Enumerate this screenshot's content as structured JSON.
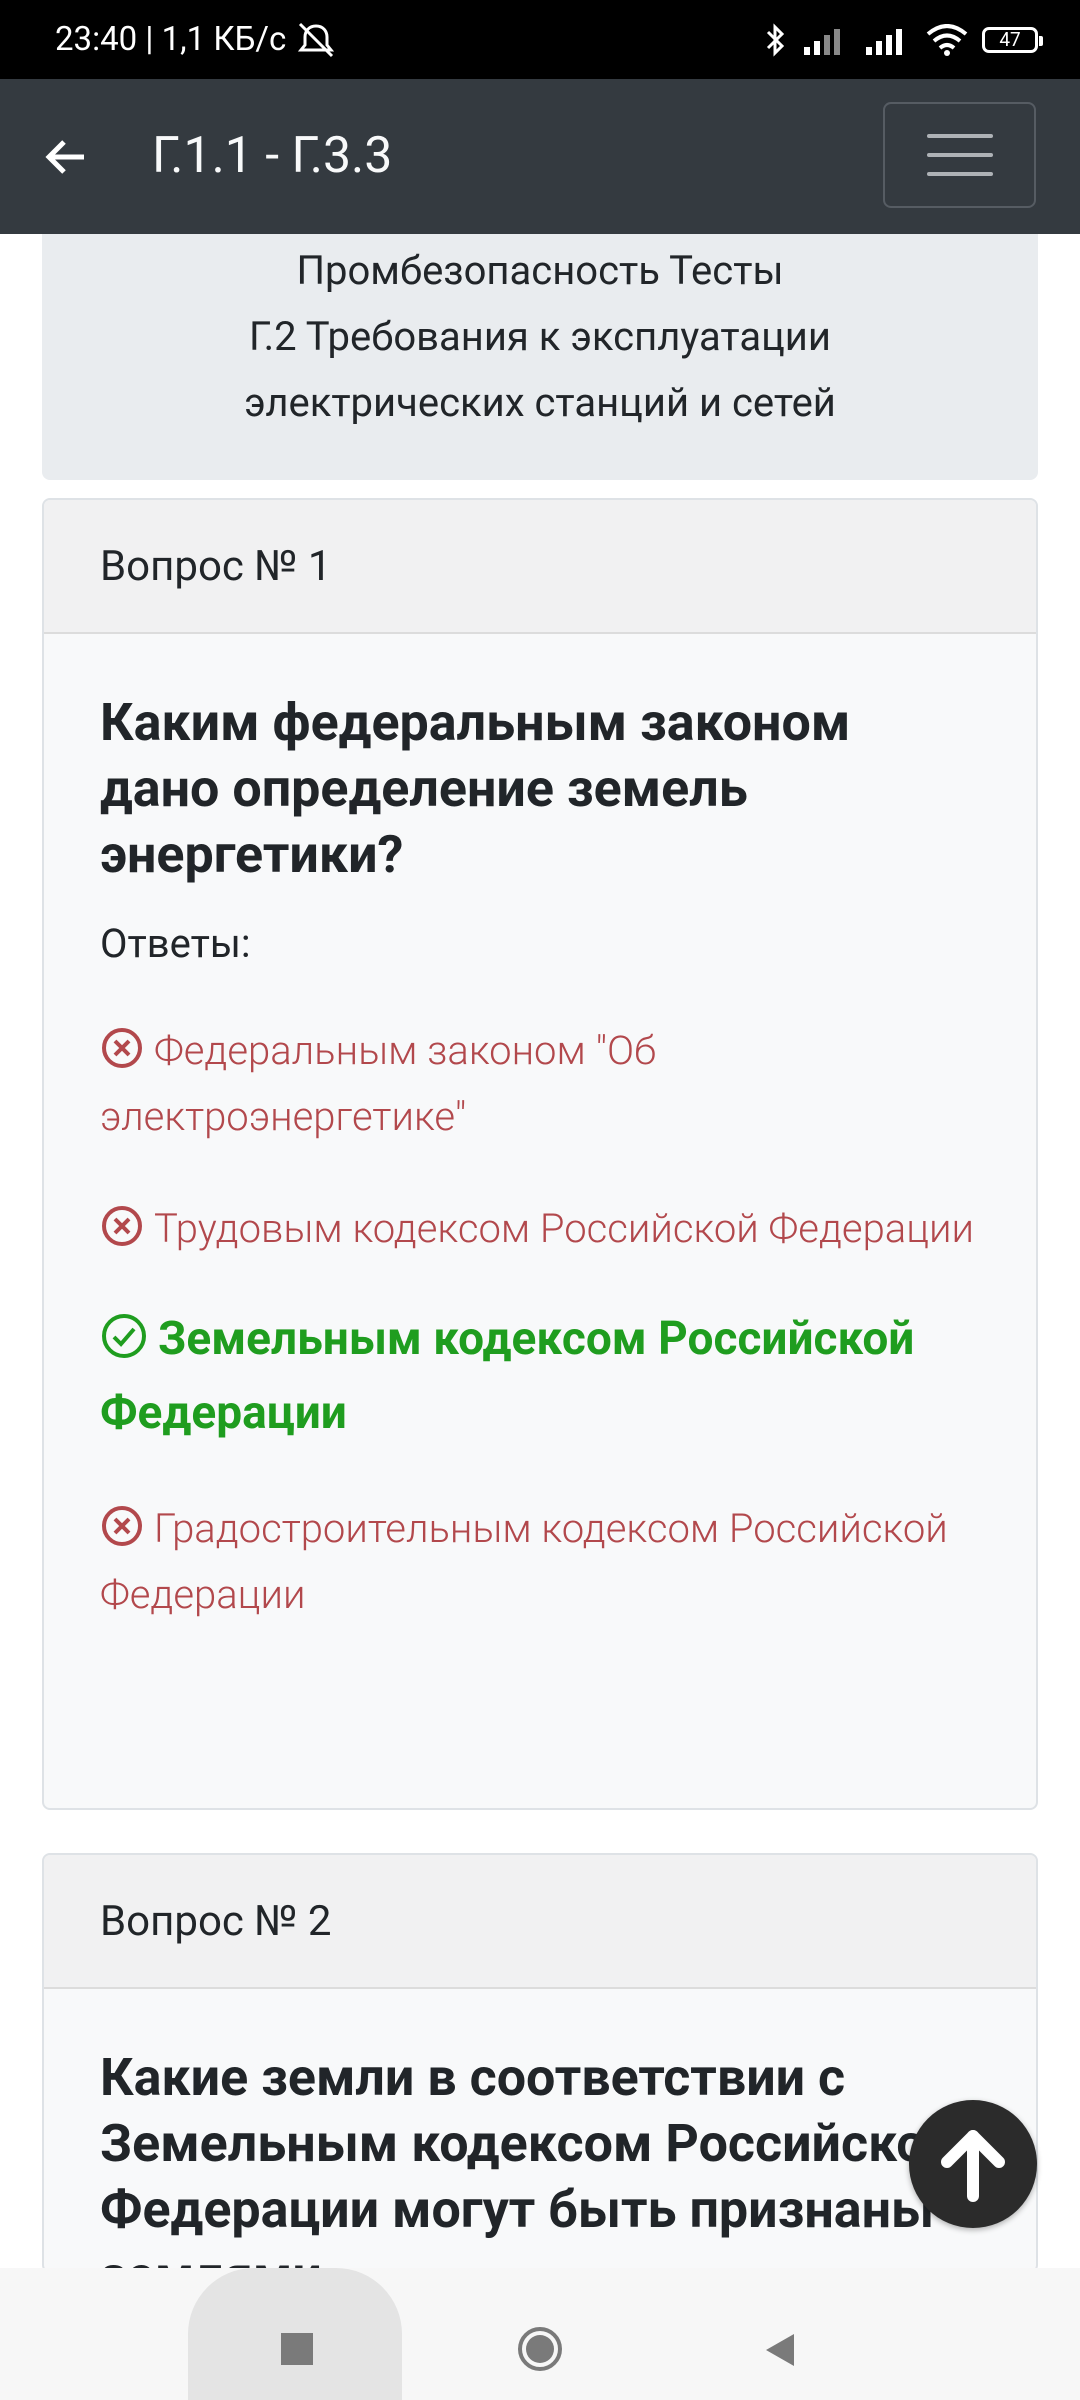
{
  "status_bar": {
    "time_speed": "23:40 | 1,1 КБ/с",
    "battery": "47"
  },
  "app_bar": {
    "title": "Г.1.1 - Г.3.3"
  },
  "info": {
    "line1": "Промбезопасность Тесты",
    "line2": "Г.2 Требования к эксплуатации",
    "line3": "электрических станций и сетей"
  },
  "questions": [
    {
      "header": "Вопрос № 1",
      "title": "Каким федеральным законом дано определение земель энергетики?",
      "answers_label": "Ответы:",
      "answers": [
        {
          "text": "Федеральным законом \"Об электроэнергетике\"",
          "correct": false
        },
        {
          "text": "Трудовым кодексом Российской Федерации",
          "correct": false
        },
        {
          "text": "Земельным кодексом Российской Федерации",
          "correct": true
        },
        {
          "text": "Градостроительным кодексом Российской Федерации",
          "correct": false
        }
      ]
    },
    {
      "header": "Вопрос № 2",
      "title": "Какие земли в соответствии с Земельным кодексом Российской Федерации могут быть признаны землями"
    }
  ],
  "colors": {
    "wrong": "#b2484c",
    "correct": "#1f9d1f",
    "appbar": "#343a40"
  }
}
